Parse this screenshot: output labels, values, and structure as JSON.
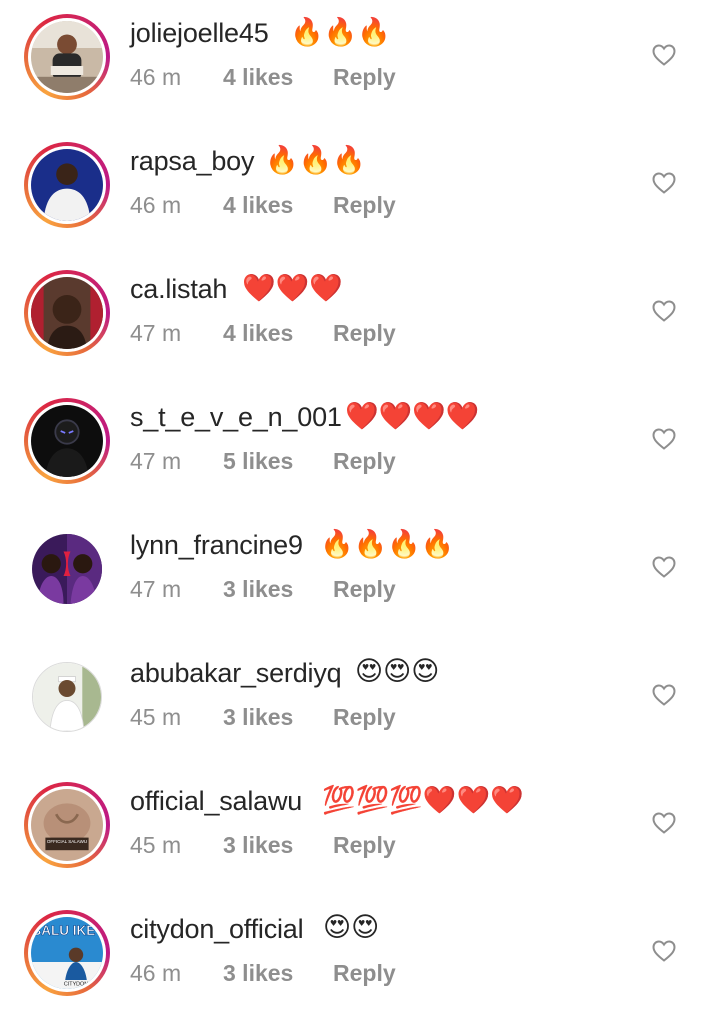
{
  "comments": [
    {
      "username": "joliejoelle45",
      "emoji": "🔥🔥🔥",
      "time": "46 m",
      "likes": "4 likes",
      "reply": "Reply",
      "avatar_icon": "user-avatar"
    },
    {
      "username": "rapsa_boy",
      "emoji": "🔥🔥🔥",
      "time": "46 m",
      "likes": "4 likes",
      "reply": "Reply",
      "avatar_icon": "user-avatar"
    },
    {
      "username": "ca.listah",
      "emoji": "❤️❤️❤️",
      "time": "47 m",
      "likes": "4 likes",
      "reply": "Reply",
      "avatar_icon": "user-avatar"
    },
    {
      "username": "s_t_e_v_e_n_001",
      "emoji": "❤️❤️❤️❤️",
      "time": "47 m",
      "likes": "5 likes",
      "reply": "Reply",
      "avatar_icon": "user-avatar"
    },
    {
      "username": "lynn_francine9",
      "emoji": "🔥🔥🔥🔥",
      "time": "47 m",
      "likes": "3 likes",
      "reply": "Reply",
      "avatar_icon": "user-avatar"
    },
    {
      "username": "abubakar_serdiyq",
      "emoji": "😍😍😍",
      "time": "45 m",
      "likes": "3 likes",
      "reply": "Reply",
      "avatar_icon": "user-avatar"
    },
    {
      "username": "official_salawu",
      "emoji": "💯💯💯❤️❤️❤️",
      "time": "45 m",
      "likes": "3 likes",
      "reply": "Reply",
      "avatar_icon": "user-avatar"
    },
    {
      "username": "citydon_official",
      "emoji": "😍😍",
      "time": "46 m",
      "likes": "3 likes",
      "reply": "Reply",
      "avatar_icon": "user-avatar"
    }
  ],
  "avatar_text": {
    "salawu_watermark": "OFFICIAL SALAWU",
    "citydon_title": "BALU IKE",
    "citydon_name": "CITYDON"
  },
  "colors": {
    "text_primary": "#262626",
    "text_secondary": "#8e8e8e",
    "story_ring_start": "#f9a33f",
    "story_ring_end": "#bc1888"
  },
  "like_icon": "heart-outline-icon"
}
